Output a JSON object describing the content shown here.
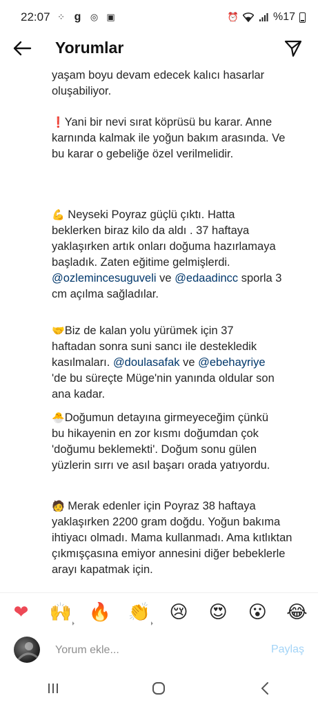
{
  "status": {
    "time": "22:07",
    "battery_text": "%17"
  },
  "app_bar": {
    "title": "Yorumlar"
  },
  "caption": {
    "p1": "yaşam boyu devam edecek kalıcı hasarlar oluşabiliyor.",
    "p2": "Yani bir nevi sırat köprüsü bu karar. Anne karnında kalmak ile yoğun bakım arasında. Ve bu karar o gebeliğe özel verilmelidir.",
    "p3_text1": "Neyseki Poyraz güçlü çıktı. Hatta beklerken biraz kilo da aldı . 37 haftaya yaklaşırken artık onları doğuma hazırlamaya başladık. Zaten eğitime gelmişlerdi. ",
    "p3_mention1": "@ozlemincesuguveli",
    "p3_text2": " ve ",
    "p3_mention2": "@edaadincc",
    "p3_text3": " sporla 3 cm açılma sağladılar.",
    "p4_text1": "Biz de kalan yolu yürümek için 37 haftadan sonra suni sancı ile destekledik kasılmaları. ",
    "p4_mention1": "@doulasafak",
    "p4_text2": " ve ",
    "p4_mention2": "@ebehayriye",
    "p4_text3": " 'de bu süreçte Müge'nin yanında oldular son ana kadar.",
    "p5": "Doğumun detayına girmeyeceğim çünkü bu hikayenin en zor kısmı doğumdan çok 'doğumu beklemekti'. Doğum sonu gülen yüzlerin sırrı ve asıl başarı orada yatıyordu.",
    "p6": " Merak edenler için Poyraz 38 haftaya yaklaşırken 2200 gram doğdu. Yoğun bakıma ihtiyacı olmadı. Mama kullanmadı. Ama kıtlıktan çıkmışçasına emiyor annesini diğer bebeklerle arayı kapatmak için."
  },
  "emojis": {
    "p2": "❗",
    "p3": "💪",
    "p4": "🤝",
    "p5": "🐣",
    "p6": "🧑"
  },
  "reactions": [
    "❤",
    "🙌",
    "🔥",
    "👏",
    "😢",
    "😍",
    "😮",
    "😂"
  ],
  "comment": {
    "placeholder": "Yorum ekle...",
    "share_label": "Paylaş"
  },
  "colors": {
    "mention": "#00376b",
    "share_disabled": "#a3d4f7",
    "heart": "#ed4956"
  }
}
